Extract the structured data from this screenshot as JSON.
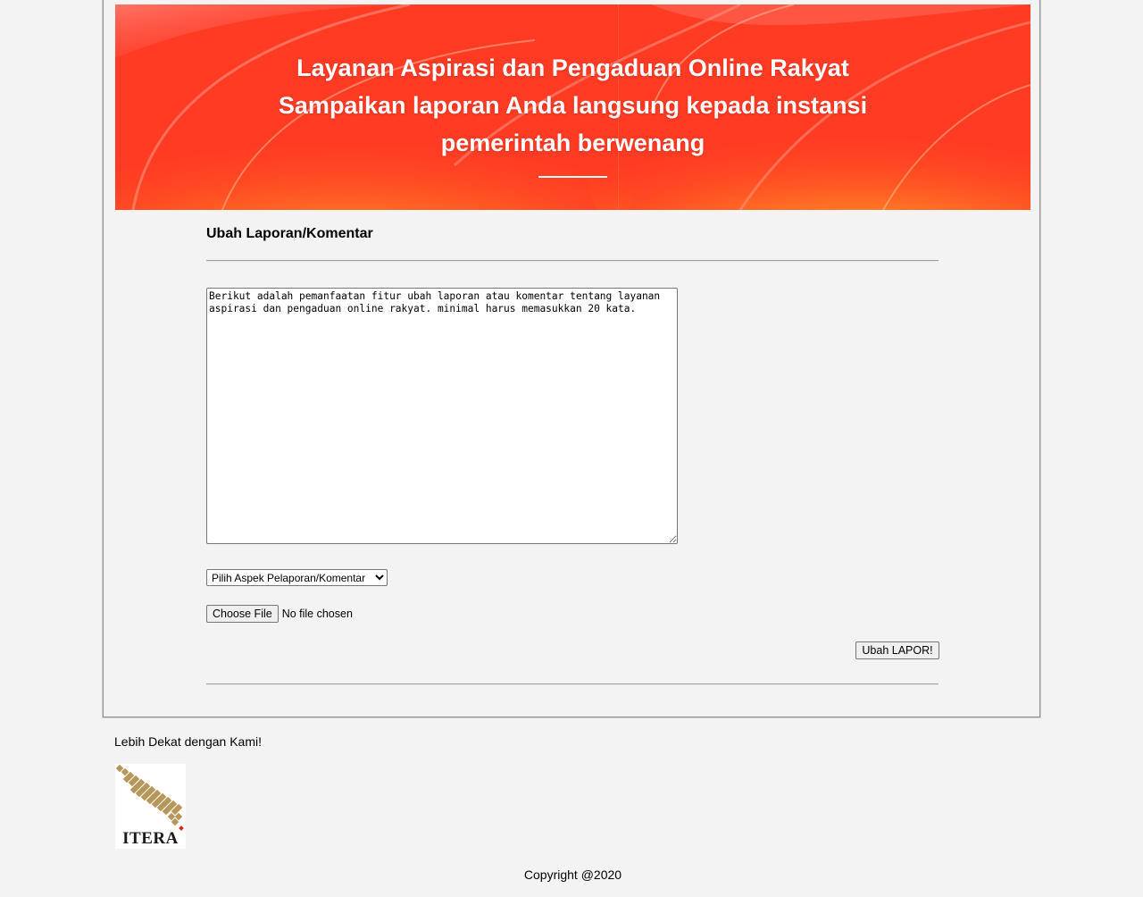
{
  "banner": {
    "line1": "Layanan Aspirasi dan Pengaduan Online Rakyat",
    "line2": "Sampaikan laporan Anda langsung kepada instansi",
    "line3": "pemerintah berwenang"
  },
  "form": {
    "title": "Ubah Laporan/Komentar",
    "report_text": "Berikut adalah pemanfaatan fitur ubah laporan atau komentar tentang layanan aspirasi dan pengaduan online rakyat. minimal harus memasukkan 20 kata.",
    "aspect_select_value": "Pilih Aspek Pelaporan/Komentar",
    "choose_file_label": "Choose File",
    "file_status": "No file chosen",
    "submit_label": "Ubah LAPOR!"
  },
  "footer": {
    "tagline": "Lebih Dekat dengan Kami!",
    "logo_text": "ITERA",
    "copyright": "Copyright @2020"
  },
  "colors": {
    "banner_red": "#ff3b24",
    "banner_orange": "#ff8a1c",
    "page_bg": "#f3f3f3",
    "logo_gold": "#b8965a"
  }
}
